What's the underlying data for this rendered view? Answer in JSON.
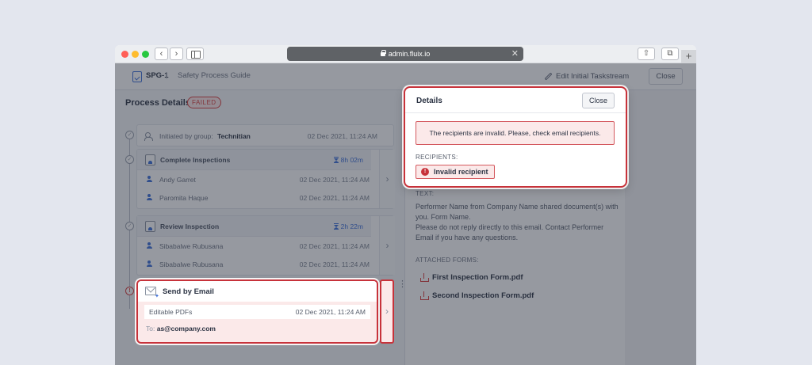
{
  "browser": {
    "url": "admin.fluix.io",
    "url_close_glyph": "✕",
    "back_glyph": "‹",
    "forward_glyph": "›",
    "share_glyph": "⇧",
    "tabs_glyph": "⧉",
    "new_tab_glyph": "+"
  },
  "header": {
    "code": "SPG-1",
    "separator": "|",
    "title": "Safety Process Guide",
    "edit_label": "Edit Initial Taskstream",
    "close_label": "Close"
  },
  "process": {
    "title": "Process Details",
    "status": "FAILED",
    "initiated": {
      "prefix": "Initiated by group:",
      "group": "Technitian",
      "date": "02 Dec 2021, 11:24 AM"
    },
    "steps": [
      {
        "name": "Complete Inspections",
        "duration": "8h 02m",
        "rows": [
          {
            "person": "Andy Garret",
            "date": "02 Dec 2021, 11:24 AM"
          },
          {
            "person": "Paromita Haque",
            "date": "02 Dec 2021, 11:24 AM"
          }
        ]
      },
      {
        "name": "Review Inspection",
        "duration": "2h 22m",
        "rows": [
          {
            "person": "Sibabalwe Rubusana",
            "date": "02 Dec 2021, 11:24 AM"
          },
          {
            "person": "Sibabalwe Rubusana",
            "date": "02 Dec 2021, 11:24 AM"
          }
        ]
      }
    ],
    "email_step": {
      "title": "Send by Email",
      "attachment_label": "Editable PDFs",
      "date": "02 Dec 2021, 11:24 AM",
      "to_label": "To:",
      "to_value": "as@company.com"
    }
  },
  "details_panel": {
    "text_label": "TEXT:",
    "text_body": [
      "Performer Name from Company Name shared document(s) with you. Form Name.",
      "Please do not reply directly to this email. Contact Performer Email if you have any questions."
    ],
    "attached_label": "ATTACHED FORMS:",
    "attached_forms": [
      "First Inspection Form.pdf",
      "Second Inspection Form.pdf"
    ]
  },
  "dialog": {
    "title": "Details",
    "close_label": "Close",
    "error_message": "The recipients are invalid. Please, check email recipients.",
    "recipients_label": "RECIPIENTS:",
    "recipient_chip": "Invalid recipient",
    "warn_glyph": "!"
  },
  "colors": {
    "accent": "#3d6fd8",
    "error": "#c7323a",
    "error_bg": "#fbe9e9"
  }
}
